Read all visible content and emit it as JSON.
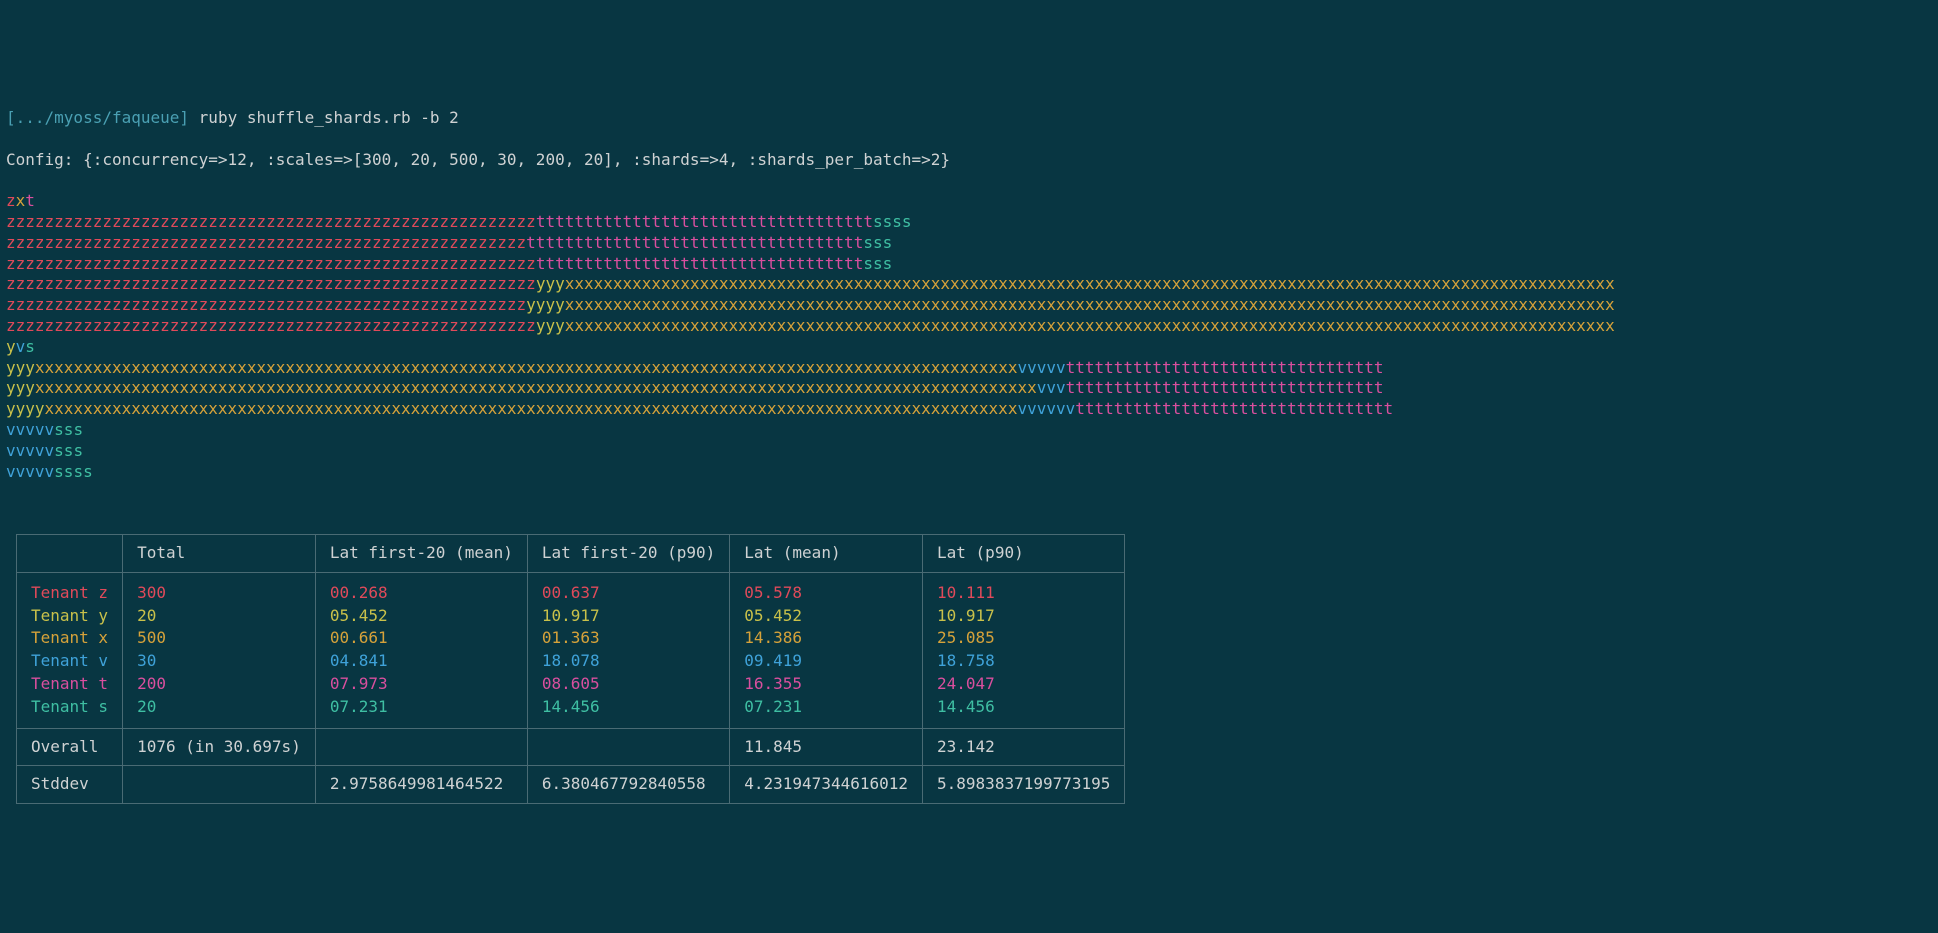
{
  "prompt": {
    "path": "[.../myoss/faqueue]",
    "command": "ruby shuffle_shards.rb -b 2"
  },
  "config_line": "Config: {:concurrency=>12, :scales=>[300, 20, 500, 30, 200, 20], :shards=>4, :shards_per_batch=>2}",
  "colors": {
    "z": "#e04a5a",
    "y": "#c9c14a",
    "x": "#d6a23a",
    "v": "#3fa2d9",
    "t": "#d94f9e",
    "s": "#3fbfa3"
  },
  "stream_lines": [
    [
      [
        "z",
        "z"
      ],
      [
        "x",
        "x"
      ],
      [
        "t",
        "t"
      ]
    ],
    [
      [
        "z",
        "zzzzzzzzzzzzzzzzzzzzzzzzzzzzzzzzzzzzzzzzzzzzzzzzzzzzzzz"
      ],
      [
        "t",
        "ttttttttttttttttttttttttttttttttttt"
      ],
      [
        "s",
        "ssss"
      ]
    ],
    [
      [
        "z",
        "zzzzzzzzzzzzzzzzzzzzzzzzzzzzzzzzzzzzzzzzzzzzzzzzzzzzzz"
      ],
      [
        "t",
        "ttttttttttttttttttttttttttttttttttt"
      ],
      [
        "s",
        "sss"
      ]
    ],
    [
      [
        "z",
        "zzzzzzzzzzzzzzzzzzzzzzzzzzzzzzzzzzzzzzzzzzzzzzzzzzzzzzz"
      ],
      [
        "t",
        "tttttttttttttttttttttttttttttttttt"
      ],
      [
        "s",
        "sss"
      ]
    ],
    [
      [
        "z",
        "zzzzzzzzzzzzzzzzzzzzzzzzzzzzzzzzzzzzzzzzzzzzzzzzzzzzzzz"
      ],
      [
        "y",
        "yyy"
      ],
      [
        "x",
        "xxxxxxxxxxxxxxxxxxxxxxxxxxxxxxxxxxxxxxxxxxxxxxxxxxxxxxxxxxxxxxxxxxxxxxxxxxxxxxxxxxxxxxxxxxxxxxxxxxxxxxxxxxxxx"
      ]
    ],
    [
      [
        "z",
        "zzzzzzzzzzzzzzzzzzzzzzzzzzzzzzzzzzzzzzzzzzzzzzzzzzzzzz"
      ],
      [
        "y",
        "yyyy"
      ],
      [
        "x",
        "xxxxxxxxxxxxxxxxxxxxxxxxxxxxxxxxxxxxxxxxxxxxxxxxxxxxxxxxxxxxxxxxxxxxxxxxxxxxxxxxxxxxxxxxxxxxxxxxxxxxxxxxxxxxx"
      ]
    ],
    [
      [
        "z",
        "zzzzzzzzzzzzzzzzzzzzzzzzzzzzzzzzzzzzzzzzzzzzzzzzzzzzzzz"
      ],
      [
        "y",
        "yyy"
      ],
      [
        "x",
        "xxxxxxxxxxxxxxxxxxxxxxxxxxxxxxxxxxxxxxxxxxxxxxxxxxxxxxxxxxxxxxxxxxxxxxxxxxxxxxxxxxxxxxxxxxxxxxxxxxxxxxxxxxxxx"
      ]
    ],
    [
      [
        "y",
        "y"
      ],
      [
        "v",
        "v"
      ],
      [
        "s",
        "s"
      ]
    ],
    [
      [
        "y",
        "yyy"
      ],
      [
        "x",
        "xxxxxxxxxxxxxxxxxxxxxxxxxxxxxxxxxxxxxxxxxxxxxxxxxxxxxxxxxxxxxxxxxxxxxxxxxxxxxxxxxxxxxxxxxxxxxxxxxxxxxx"
      ],
      [
        "v",
        "vvvvv"
      ],
      [
        "t",
        "ttttttttttttttttttttttttttttttttt"
      ]
    ],
    [
      [
        "y",
        "yyy"
      ],
      [
        "x",
        "xxxxxxxxxxxxxxxxxxxxxxxxxxxxxxxxxxxxxxxxxxxxxxxxxxxxxxxxxxxxxxxxxxxxxxxxxxxxxxxxxxxxxxxxxxxxxxxxxxxxxxxx"
      ],
      [
        "v",
        "vvv"
      ],
      [
        "t",
        "ttttttttttttttttttttttttttttttttt"
      ]
    ],
    [
      [
        "y",
        "yyyy"
      ],
      [
        "x",
        "xxxxxxxxxxxxxxxxxxxxxxxxxxxxxxxxxxxxxxxxxxxxxxxxxxxxxxxxxxxxxxxxxxxxxxxxxxxxxxxxxxxxxxxxxxxxxxxxxxxxx"
      ],
      [
        "v",
        "vvvvvv"
      ],
      [
        "t",
        "ttttttttttttttttttttttttttttttttt"
      ]
    ],
    [
      [
        "v",
        "vvvvv"
      ],
      [
        "s",
        "sss"
      ]
    ],
    [
      [
        "v",
        "vvvvv"
      ],
      [
        "s",
        "sss"
      ]
    ],
    [
      [
        "v",
        "vvvvv"
      ],
      [
        "s",
        "ssss"
      ]
    ]
  ],
  "table": {
    "headers": [
      "",
      "Total",
      "Lat first-20 (mean)",
      "Lat first-20 (p90)",
      "Lat (mean)",
      "Lat (p90)"
    ],
    "tenants": [
      {
        "key": "z",
        "label": "Tenant z",
        "total": "300",
        "f20mean": "00.268",
        "f20p90": "00.637",
        "mean": "05.578",
        "p90": "10.111"
      },
      {
        "key": "y",
        "label": "Tenant y",
        "total": "20",
        "f20mean": "05.452",
        "f20p90": "10.917",
        "mean": "05.452",
        "p90": "10.917"
      },
      {
        "key": "x",
        "label": "Tenant x",
        "total": "500",
        "f20mean": "00.661",
        "f20p90": "01.363",
        "mean": "14.386",
        "p90": "25.085"
      },
      {
        "key": "v",
        "label": "Tenant v",
        "total": "30",
        "f20mean": "04.841",
        "f20p90": "18.078",
        "mean": "09.419",
        "p90": "18.758"
      },
      {
        "key": "t",
        "label": "Tenant t",
        "total": "200",
        "f20mean": "07.973",
        "f20p90": "08.605",
        "mean": "16.355",
        "p90": "24.047"
      },
      {
        "key": "s",
        "label": "Tenant s",
        "total": "20",
        "f20mean": "07.231",
        "f20p90": "14.456",
        "mean": "07.231",
        "p90": "14.456"
      }
    ],
    "overall": {
      "label": "Overall",
      "total": "1076 (in 30.697s)",
      "f20mean": "",
      "f20p90": "",
      "mean": "11.845",
      "p90": "23.142"
    },
    "stddev": {
      "label": "Stddev",
      "total": "",
      "f20mean": "2.9758649981464522",
      "f20p90": "6.380467792840558",
      "mean": "4.231947344616012",
      "p90": "5.8983837199773195"
    }
  }
}
